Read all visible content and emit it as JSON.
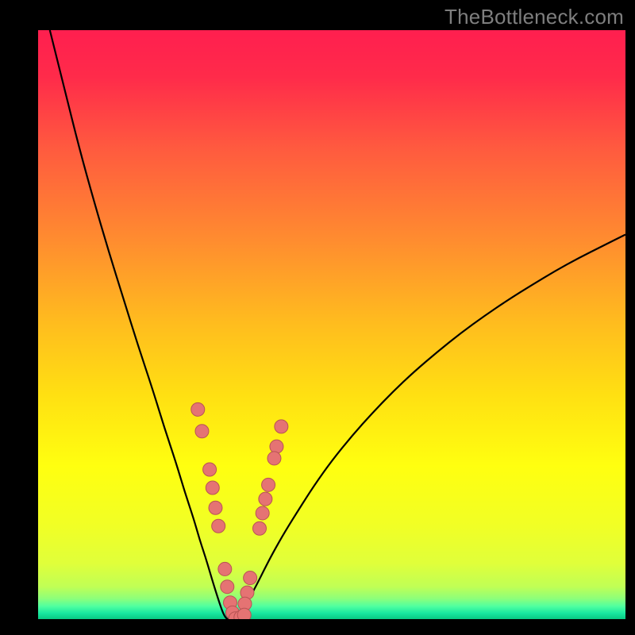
{
  "watermark": "TheBottleneck.com",
  "colors": {
    "black": "#000000",
    "curve": "#000000",
    "dot_fill": "#e57373",
    "dot_stroke": "#b85454"
  },
  "gradient_stops": [
    {
      "offset": 0.0,
      "color": "#ff1f4f"
    },
    {
      "offset": 0.08,
      "color": "#ff2b4a"
    },
    {
      "offset": 0.2,
      "color": "#ff5a3f"
    },
    {
      "offset": 0.35,
      "color": "#ff8a30"
    },
    {
      "offset": 0.5,
      "color": "#ffbd1e"
    },
    {
      "offset": 0.62,
      "color": "#ffe012"
    },
    {
      "offset": 0.74,
      "color": "#ffff10"
    },
    {
      "offset": 0.84,
      "color": "#f1ff25"
    },
    {
      "offset": 0.905,
      "color": "#e0ff3a"
    },
    {
      "offset": 0.945,
      "color": "#c0ff55"
    },
    {
      "offset": 0.965,
      "color": "#8dff7a"
    },
    {
      "offset": 0.978,
      "color": "#50ffa0"
    },
    {
      "offset": 0.99,
      "color": "#18e8a0"
    },
    {
      "offset": 1.0,
      "color": "#08c983"
    }
  ],
  "chart_data": {
    "type": "line",
    "title": "",
    "xlabel": "",
    "ylabel": "",
    "xlim": [
      0,
      100
    ],
    "ylim": [
      0,
      100
    ],
    "x": [
      2.0,
      4.5,
      7.0,
      9.5,
      12.0,
      14.5,
      17.0,
      19.5,
      21.5,
      23.5,
      25.0,
      26.5,
      27.5,
      28.5,
      29.3,
      30.0,
      30.6,
      31.1,
      31.5,
      31.9,
      32.2,
      32.6,
      33.0,
      34.0,
      35.0,
      36.0,
      37.2,
      38.5,
      40.0,
      42.0,
      44.5,
      47.0,
      50.0,
      53.5,
      57.0,
      60.5,
      64.0,
      68.0,
      72.0,
      76.0,
      80.0,
      84.0,
      88.0,
      92.0,
      96.0,
      100.0
    ],
    "y": [
      100.0,
      90.0,
      80.0,
      71.0,
      62.5,
      54.5,
      46.5,
      39.0,
      32.5,
      26.5,
      21.5,
      17.0,
      13.5,
      10.5,
      7.8,
      5.5,
      3.6,
      2.1,
      1.0,
      0.3,
      0.0,
      0.0,
      0.1,
      0.8,
      1.9,
      3.6,
      5.8,
      8.4,
      11.3,
      14.8,
      18.8,
      22.7,
      26.9,
      31.2,
      35.1,
      38.7,
      42.0,
      45.4,
      48.6,
      51.5,
      54.2,
      56.7,
      59.1,
      61.3,
      63.3,
      65.3
    ],
    "markers_left": [
      {
        "x": 27.2,
        "y": 35.6
      },
      {
        "x": 27.9,
        "y": 31.9
      },
      {
        "x": 29.2,
        "y": 25.4
      },
      {
        "x": 29.7,
        "y": 22.3
      },
      {
        "x": 30.2,
        "y": 18.9
      },
      {
        "x": 30.7,
        "y": 15.8
      },
      {
        "x": 31.8,
        "y": 8.5
      },
      {
        "x": 32.2,
        "y": 5.5
      },
      {
        "x": 32.7,
        "y": 2.8
      },
      {
        "x": 33.1,
        "y": 1.1
      }
    ],
    "markers_right": [
      {
        "x": 41.4,
        "y": 32.7
      },
      {
        "x": 40.6,
        "y": 29.3
      },
      {
        "x": 40.2,
        "y": 27.3
      },
      {
        "x": 39.2,
        "y": 22.8
      },
      {
        "x": 38.7,
        "y": 20.4
      },
      {
        "x": 38.2,
        "y": 18.0
      },
      {
        "x": 37.7,
        "y": 15.4
      },
      {
        "x": 36.1,
        "y": 7.0
      },
      {
        "x": 35.6,
        "y": 4.5
      },
      {
        "x": 35.2,
        "y": 2.6
      }
    ],
    "markers_bottom": [
      {
        "x": 33.6,
        "y": 0.1
      },
      {
        "x": 34.5,
        "y": 0.3
      },
      {
        "x": 35.1,
        "y": 0.7
      }
    ]
  }
}
